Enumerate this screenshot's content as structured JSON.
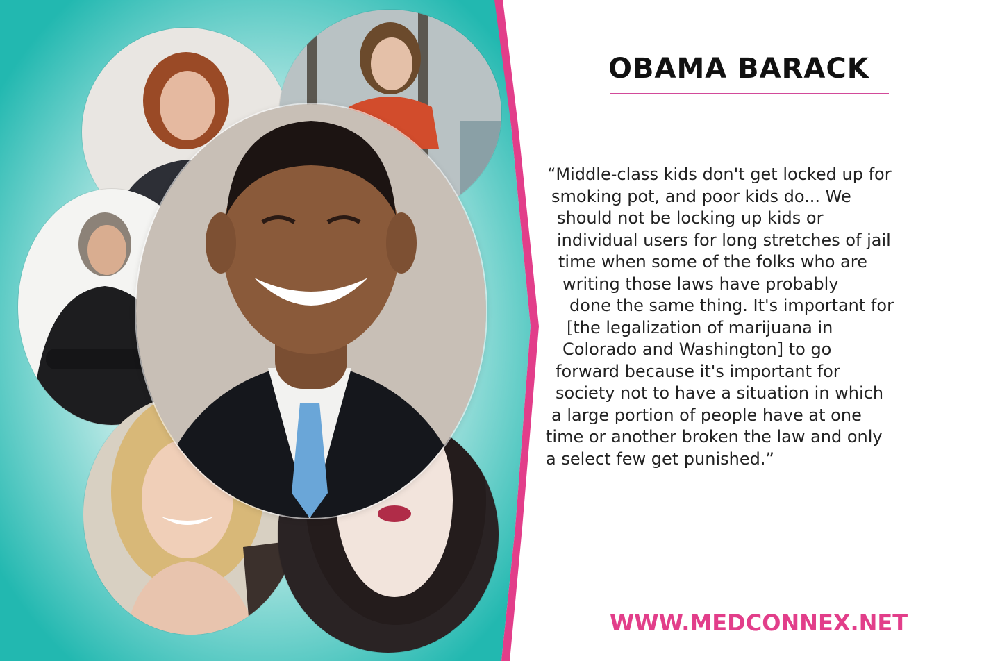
{
  "header": {
    "title": "OBAMA BARACK"
  },
  "quote": {
    "lines": [
      "“Middle-class kids don't get locked up for",
      "smoking pot, and poor kids do... We",
      "should not be locking up kids or",
      "individual users for long stretches of jail",
      "time when some of the folks who are",
      "writing those laws have probably",
      "done the same thing. It's important for",
      "[the legalization of marijuana in",
      "Colorado and Washington] to go",
      "forward because it's important for",
      "society not to have a situation in which",
      "a large portion of people have at one",
      "time or another broken the law and only",
      "a select few get punished.”"
    ]
  },
  "footer": {
    "website": "WWW.MEDCONNEX.NET"
  },
  "colors": {
    "teal": "#22b8b0",
    "pink_accent": "#e23e8a",
    "title_text": "#111111",
    "body_text": "#222222"
  },
  "photos": [
    {
      "id": "portrait-woman-red-hair",
      "icon": "person-photo"
    },
    {
      "id": "portrait-woman-glasses",
      "icon": "person-photo"
    },
    {
      "id": "portrait-man-arms-crossed",
      "icon": "person-photo"
    },
    {
      "id": "portrait-main-smiling-man",
      "icon": "person-photo"
    },
    {
      "id": "portrait-woman-blonde",
      "icon": "person-photo"
    },
    {
      "id": "portrait-woman-dark-hair",
      "icon": "person-photo"
    }
  ]
}
